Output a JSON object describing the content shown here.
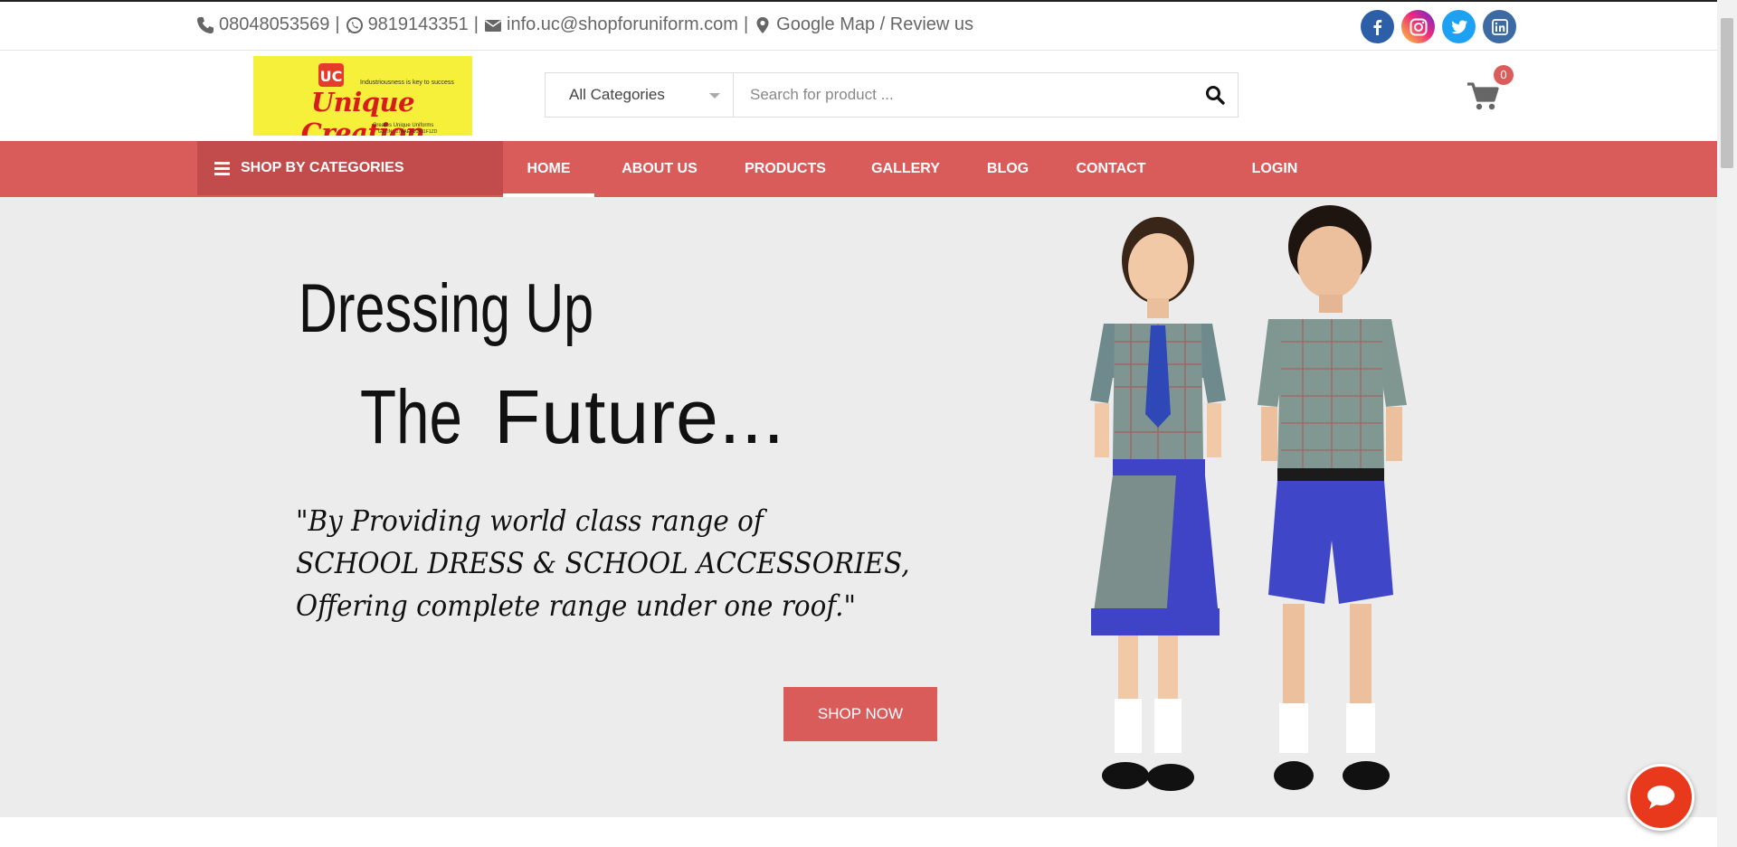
{
  "topbar": {
    "phone1": "08048053569",
    "phone2": "9819143351",
    "email": "info.uc@shopforuniform.com",
    "map_link": "Google Map / Review us",
    "separator": "|",
    "social": [
      {
        "name": "facebook-icon",
        "glyph": "f",
        "color": "#2d5fa8"
      },
      {
        "name": "instagram-icon",
        "glyph": "",
        "color": "#c13584"
      },
      {
        "name": "twitter-icon",
        "glyph": "",
        "color": "#1da1f2"
      },
      {
        "name": "linkedin-icon",
        "glyph": "in",
        "color": "#3b6aa5"
      }
    ]
  },
  "logo": {
    "tagline": "Industriousness is key to success",
    "name": "Unique Creation",
    "sub": "Creates Unique Uniforms",
    "gst": "GSTIN : 27AAEFU1431F1ZD",
    "mark": "UC"
  },
  "search": {
    "category": "All Categories",
    "placeholder": "Search for product ..."
  },
  "cart": {
    "count": "0"
  },
  "nav": {
    "shop_by": "SHOP BY CATEGORIES",
    "items": [
      "HOME",
      "ABOUT US",
      "PRODUCTS",
      "GALLERY",
      "BLOG",
      "CONTACT",
      "LOGIN"
    ],
    "active": "HOME"
  },
  "hero": {
    "line1": "Dressing Up",
    "line2_a": "The",
    "line2_b": "Future...",
    "quote1": "\"By Providing world class range of",
    "quote2": "SCHOOL DRESS & SCHOOL ACCESSORIES,",
    "quote3": "Offering complete range under one roof.\"",
    "cta": "SHOP NOW"
  },
  "colors": {
    "accent": "#d95c5a",
    "accent_dark": "#c14c4b",
    "logo_bg": "#f6f03a",
    "logo_text": "#d81b1b",
    "chat": "#e8391c"
  }
}
